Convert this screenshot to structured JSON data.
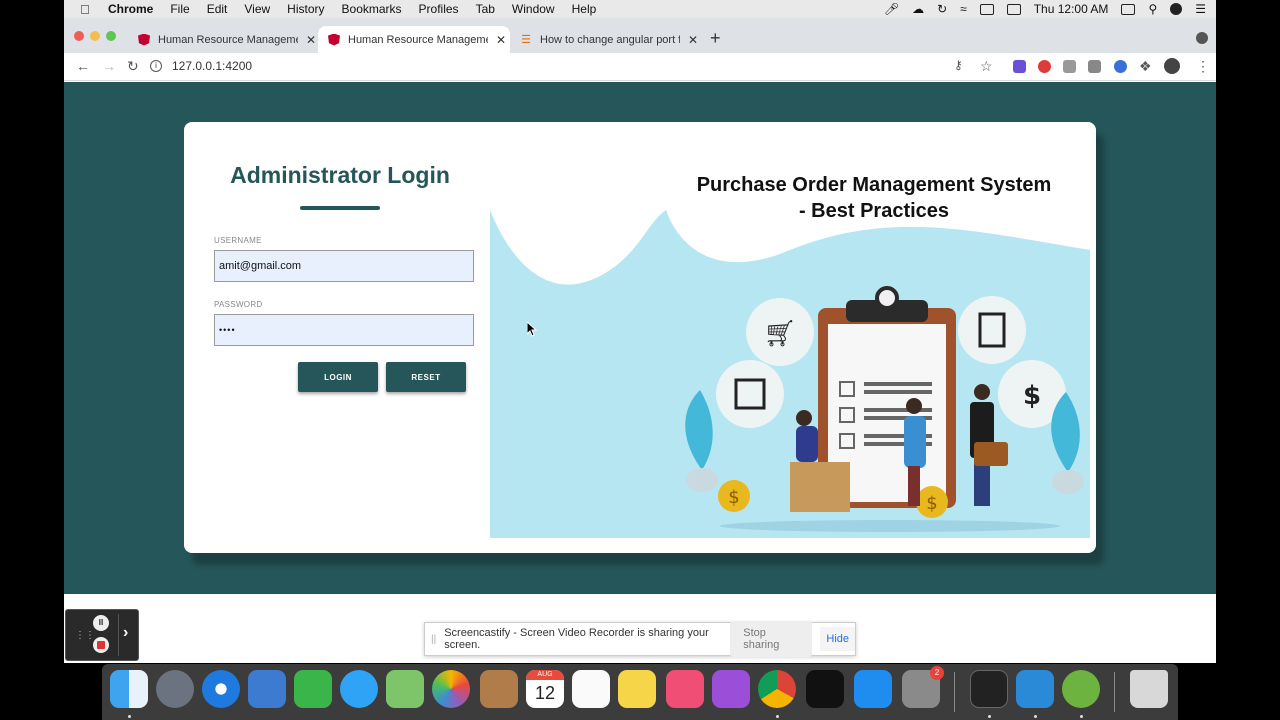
{
  "menubar": {
    "app": "Chrome",
    "items": [
      "File",
      "Edit",
      "View",
      "History",
      "Bookmarks",
      "Profiles",
      "Tab",
      "Window",
      "Help"
    ],
    "clock": "Thu 12:00 AM"
  },
  "tabs": [
    {
      "title": "Human Resource Management",
      "icon": "angular-icon"
    },
    {
      "title": "Human Resource Management",
      "icon": "angular-icon"
    },
    {
      "title": "How to change angular port fro",
      "icon": "stackoverflow-icon"
    }
  ],
  "address": {
    "url": "127.0.0.1:4200"
  },
  "login": {
    "title": "Administrator Login",
    "username_label": "USERNAME",
    "username_value": "amit@gmail.com",
    "password_label": "PASSWORD",
    "password_value": "••••",
    "login_button": "LOGIN",
    "reset_button": "RESET"
  },
  "illustration": {
    "title_line1": "Purchase Order Management System",
    "title_line2": "- Best Practices"
  },
  "sharebar": {
    "message": "Screencastify - Screen Video Recorder is sharing your screen.",
    "stop_label": "Stop sharing",
    "hide_label": "Hide"
  },
  "dock": {
    "calendar_month": "AUG",
    "calendar_day": "12",
    "settings_badge": "2"
  },
  "colors": {
    "page_background": "#255659",
    "primary": "#255659",
    "illustration_bg": "#b5e6f2"
  }
}
